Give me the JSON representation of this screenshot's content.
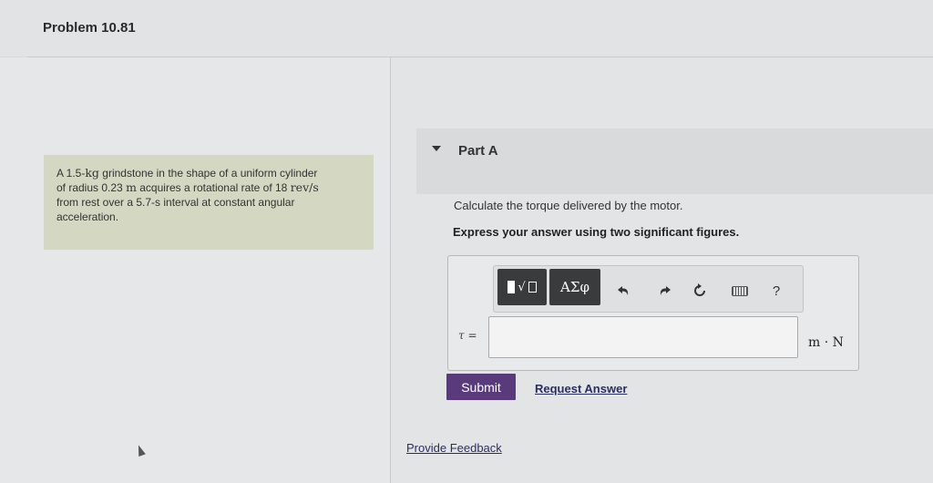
{
  "header": {
    "title": "Problem 10.81"
  },
  "problem": {
    "line1_pre": "A 1.5-",
    "line1_kg": "kg",
    "line1_post": " grindstone in the shape of a uniform cylinder",
    "line2_pre": "of radius 0.23 ",
    "line2_m": "m",
    "line2_post": " acquires a rotational rate of 18 ",
    "line2_unit": "rev/s",
    "line3": "from rest over a 5.7-s interval at constant angular",
    "line4": "acceleration."
  },
  "part": {
    "label": "Part A"
  },
  "prompt": {
    "question": "Calculate the torque delivered by the motor.",
    "instruction": "Express your answer using two significant figures."
  },
  "toolbar": {
    "math_radical": "√",
    "greek_label": "ΑΣφ",
    "undo_icon": "undo-icon",
    "redo_icon": "redo-icon",
    "reset_icon": "reset-icon",
    "keyboard_icon": "keyboard-icon",
    "help_label": "?"
  },
  "answer": {
    "variable": "τ =",
    "value": "",
    "units": "m · N"
  },
  "actions": {
    "submit": "Submit",
    "request_answer": "Request Answer",
    "provide_feedback": "Provide Feedback"
  }
}
